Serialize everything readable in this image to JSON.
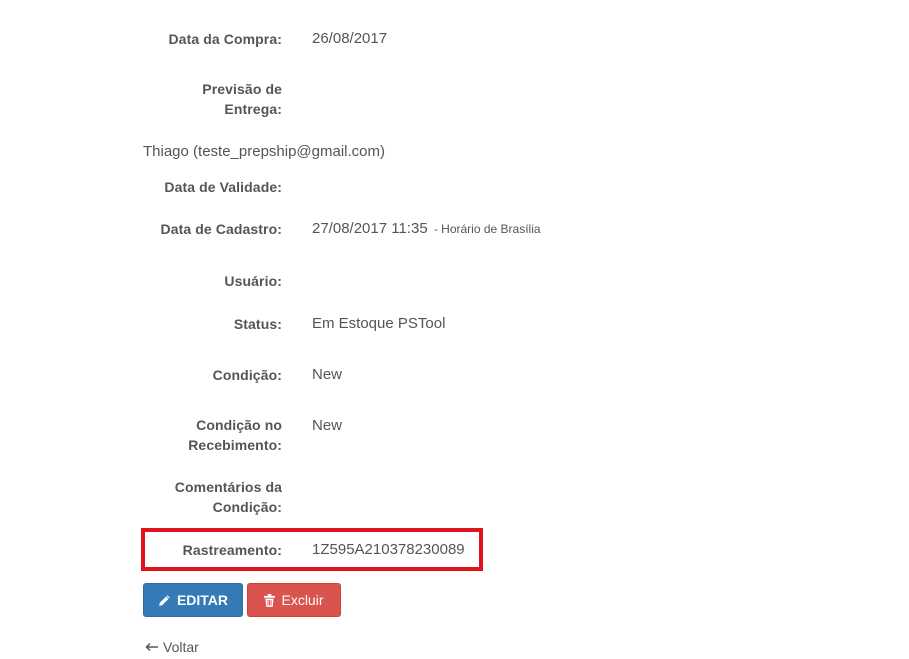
{
  "details": {
    "data_compra": {
      "label": "Data da Compra:",
      "value": "26/08/2017"
    },
    "previsao_entrega": {
      "label_line1": "Previsão de",
      "label_line2": "Entrega:",
      "value": ""
    },
    "owner": "Thiago (teste_prepship@gmail.com)",
    "data_validade": {
      "label": "Data de Validade:",
      "value": ""
    },
    "data_cadastro": {
      "label": "Data de Cadastro:",
      "value": "27/08/2017 11:35",
      "suffix": "- Horário de Brasília"
    },
    "usuario": {
      "label": "Usuário:",
      "value": ""
    },
    "status": {
      "label": "Status:",
      "value": "Em Estoque PSTool"
    },
    "condicao": {
      "label": "Condição:",
      "value": "New"
    },
    "condicao_recebimento": {
      "label_line1": "Condição no",
      "label_line2": "Recebimento:",
      "value": "New"
    },
    "comentarios_condicao": {
      "label_line1": "Comentários da",
      "label_line2": "Condição:",
      "value": ""
    },
    "rastreamento": {
      "label": "Rastreamento:",
      "value": "1Z595A210378230089"
    }
  },
  "actions": {
    "edit_label": "EDITAR",
    "delete_label": "Excluir",
    "back_label": "Voltar"
  },
  "icons": {
    "edit": "pencil-icon",
    "delete": "trash-icon",
    "back": "arrow-left-icon"
  },
  "colors": {
    "edit_button": "#337ab7",
    "delete_button": "#d9534f",
    "highlight_border": "#e0141e"
  }
}
